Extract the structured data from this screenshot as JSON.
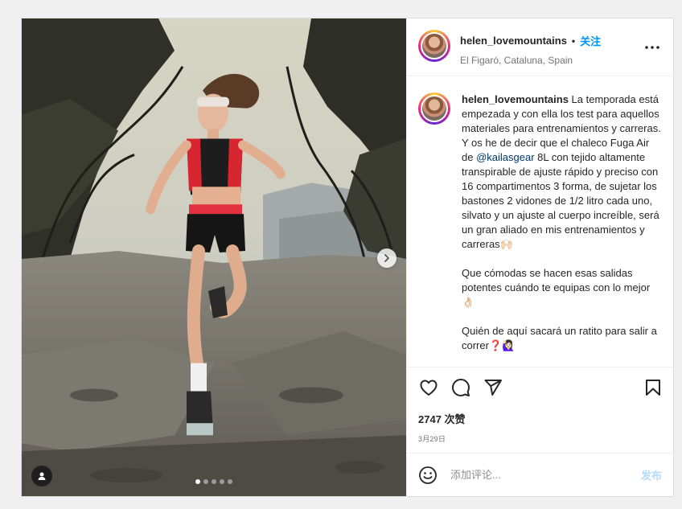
{
  "post": {
    "username": "helen_lovemountains",
    "separator": "•",
    "follow_label": "关注",
    "location": "El Figaró, Cataluna, Spain",
    "media": {
      "image_count": 5,
      "active_index": 0,
      "next_icon": "chevron-right-icon",
      "tag_icon": "user-tag-icon"
    },
    "caption": {
      "username": "helen_lovemountains",
      "intro": " La temporada está empezada y con ella los test para aquellos materiales para entrenamientos y carreras.",
      "line2_pre": "Y os he de decir que el chaleco Fuga Air de ",
      "mention": "@kailasgear",
      "line2_post": " 8L con tejido altamente transpirable de ajuste rápido y preciso con 16 compartimentos 3 forma, de sujetar los bastones 2 vidones de 1/2 litro cada uno, silvato y un ajuste al cuerpo increíble, será un gran aliado en mis entrenamientos y carreras🙌🏻",
      "para2": "Que cómodas se hacen esas salidas potentes cuándo te equipas con lo mejor 👌🏻",
      "para3": "Quién de aquí sacará un ratito para salir a correr❓🙋🏻‍♀️"
    },
    "likes_label": "2747 次赞",
    "date": "3月29日",
    "comment_placeholder": "添加评论...",
    "post_label": "发布",
    "colors": {
      "accent": "#0095f6",
      "post_disabled": "#b3dbff",
      "mention": "#00376b"
    },
    "icons": [
      "heart-icon",
      "comment-icon",
      "share-icon",
      "bookmark-icon",
      "emoji-icon",
      "more-icon"
    ]
  }
}
